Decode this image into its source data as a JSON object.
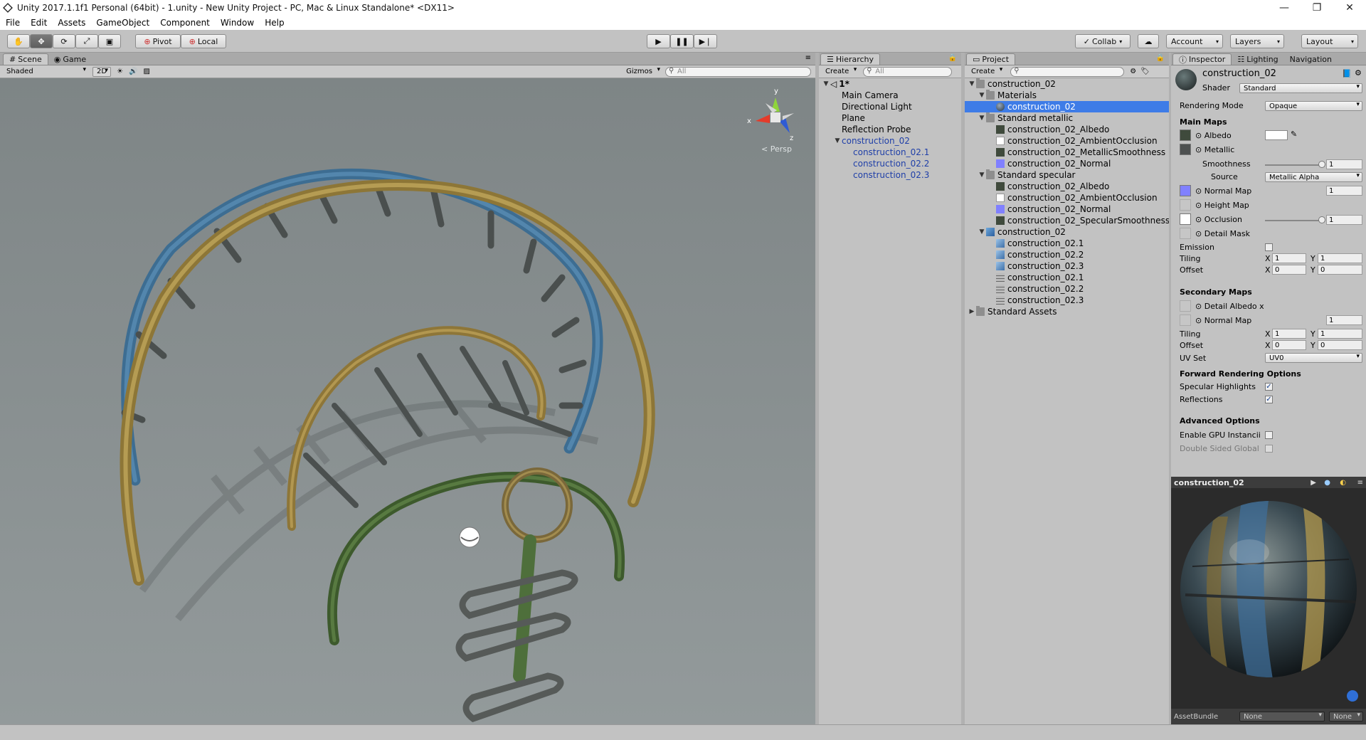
{
  "window": {
    "title": "Unity 2017.1.1f1 Personal (64bit) - 1.unity - New Unity Project - PC, Mac & Linux Standalone* <DX11>",
    "controls": [
      "—",
      "❐",
      "✕"
    ]
  },
  "menu": [
    "File",
    "Edit",
    "Assets",
    "GameObject",
    "Component",
    "Window",
    "Help"
  ],
  "toolbar": {
    "pivot": "Pivot",
    "local": "Local",
    "collab": "Collab",
    "account": "Account",
    "layers": "Layers",
    "layout": "Layout"
  },
  "scene": {
    "tabs": [
      "Scene",
      "Game"
    ],
    "shading": "Shaded",
    "mode2d": "2D",
    "gizmos": "Gizmos",
    "search_placeholder": "All",
    "persp_label": "< Persp",
    "gizmo_axes": {
      "x": "x",
      "y": "y",
      "z": "z"
    }
  },
  "hierarchy": {
    "tab": "Hierarchy",
    "create": "Create",
    "search_placeholder": "All",
    "scene_name": "1*",
    "items": [
      {
        "label": "Main Camera",
        "indent": 1,
        "blue": false,
        "arrow": ""
      },
      {
        "label": "Directional Light",
        "indent": 1,
        "blue": false,
        "arrow": ""
      },
      {
        "label": "Plane",
        "indent": 1,
        "blue": false,
        "arrow": ""
      },
      {
        "label": "Reflection Probe",
        "indent": 1,
        "blue": false,
        "arrow": ""
      },
      {
        "label": "construction_02",
        "indent": 1,
        "blue": true,
        "arrow": "▼"
      },
      {
        "label": "construction_02.1",
        "indent": 2,
        "blue": true,
        "arrow": ""
      },
      {
        "label": "construction_02.2",
        "indent": 2,
        "blue": true,
        "arrow": ""
      },
      {
        "label": "construction_02.3",
        "indent": 2,
        "blue": true,
        "arrow": ""
      }
    ]
  },
  "project": {
    "tab": "Project",
    "create": "Create",
    "items": [
      {
        "label": "construction_02",
        "indent": 0,
        "kind": "folder",
        "arrow": "▼"
      },
      {
        "label": "Materials",
        "indent": 1,
        "kind": "folder",
        "arrow": "▼"
      },
      {
        "label": "construction_02",
        "indent": 2,
        "kind": "material",
        "arrow": "",
        "selected": true
      },
      {
        "label": "Standard metallic",
        "indent": 1,
        "kind": "folder",
        "arrow": "▼"
      },
      {
        "label": "construction_02_Albedo",
        "indent": 2,
        "kind": "tex-dark",
        "arrow": ""
      },
      {
        "label": "construction_02_AmbientOcclusion",
        "indent": 2,
        "kind": "tex-white",
        "arrow": ""
      },
      {
        "label": "construction_02_MetallicSmoothness",
        "indent": 2,
        "kind": "tex-dark",
        "arrow": ""
      },
      {
        "label": "construction_02_Normal",
        "indent": 2,
        "kind": "tex-normal",
        "arrow": ""
      },
      {
        "label": "Standard specular",
        "indent": 1,
        "kind": "folder",
        "arrow": "▼"
      },
      {
        "label": "construction_02_Albedo",
        "indent": 2,
        "kind": "tex-dark",
        "arrow": ""
      },
      {
        "label": "construction_02_AmbientOcclusion",
        "indent": 2,
        "kind": "tex-white",
        "arrow": ""
      },
      {
        "label": "construction_02_Normal",
        "indent": 2,
        "kind": "tex-normal",
        "arrow": ""
      },
      {
        "label": "construction_02_SpecularSmoothness",
        "indent": 2,
        "kind": "tex-dark",
        "arrow": ""
      },
      {
        "label": "construction_02",
        "indent": 1,
        "kind": "model",
        "arrow": "▼"
      },
      {
        "label": "construction_02.1",
        "indent": 2,
        "kind": "mesh",
        "arrow": ""
      },
      {
        "label": "construction_02.2",
        "indent": 2,
        "kind": "mesh",
        "arrow": ""
      },
      {
        "label": "construction_02.3",
        "indent": 2,
        "kind": "mesh",
        "arrow": ""
      },
      {
        "label": "construction_02.1",
        "indent": 2,
        "kind": "grid",
        "arrow": ""
      },
      {
        "label": "construction_02.2",
        "indent": 2,
        "kind": "grid",
        "arrow": ""
      },
      {
        "label": "construction_02.3",
        "indent": 2,
        "kind": "grid",
        "arrow": ""
      },
      {
        "label": "Standard Assets",
        "indent": 0,
        "kind": "folder",
        "arrow": "▶"
      }
    ]
  },
  "inspector": {
    "tabs": [
      "Inspector",
      "Lighting",
      "Navigation"
    ],
    "material_name": "construction_02",
    "shader_label": "Shader",
    "shader_value": "Standard",
    "rendering_mode_label": "Rendering Mode",
    "rendering_mode_value": "Opaque",
    "main_maps": "Main Maps",
    "albedo": "Albedo",
    "metallic": "Metallic",
    "smoothness": "Smoothness",
    "smoothness_value": "1",
    "smoothness_level": 1.0,
    "source_label": "Source",
    "source_value": "Metallic Alpha",
    "normal_map": "Normal Map",
    "normal_map_value": "1",
    "height_map": "Height Map",
    "occlusion": "Occlusion",
    "occlusion_value": "1",
    "occlusion_level": 1.0,
    "detail_mask": "Detail Mask",
    "emission": "Emission",
    "tiling": "Tiling",
    "offset": "Offset",
    "x": "X",
    "y": "Y",
    "tiling_x": "1",
    "tiling_y": "1",
    "offset_x": "0",
    "offset_y": "0",
    "secondary_maps": "Secondary Maps",
    "detail_albedo": "Detail Albedo x",
    "normal_map2": "Normal Map",
    "normal_map2_value": "1",
    "tiling2_x": "1",
    "tiling2_y": "1",
    "offset2_x": "0",
    "offset2_y": "0",
    "uv_set": "UV Set",
    "uv_set_value": "UV0",
    "forward_rendering": "Forward Rendering Options",
    "specular_highlights": "Specular Highlights",
    "reflections": "Reflections",
    "advanced": "Advanced Options",
    "gpu_instancing": "Enable GPU Instancii",
    "double_sided": "Double Sided Global"
  },
  "preview": {
    "title": "construction_02",
    "assetbundle": "AssetBundle",
    "none1": "None",
    "none2": "None"
  },
  "colors": {
    "selection": "#3e7ce7",
    "blue_prefab": "#1f3fa8",
    "pipe_blue": "#4d7fa3",
    "pipe_yellow": "#b59a4e",
    "pipe_green": "#4e6f3b"
  }
}
